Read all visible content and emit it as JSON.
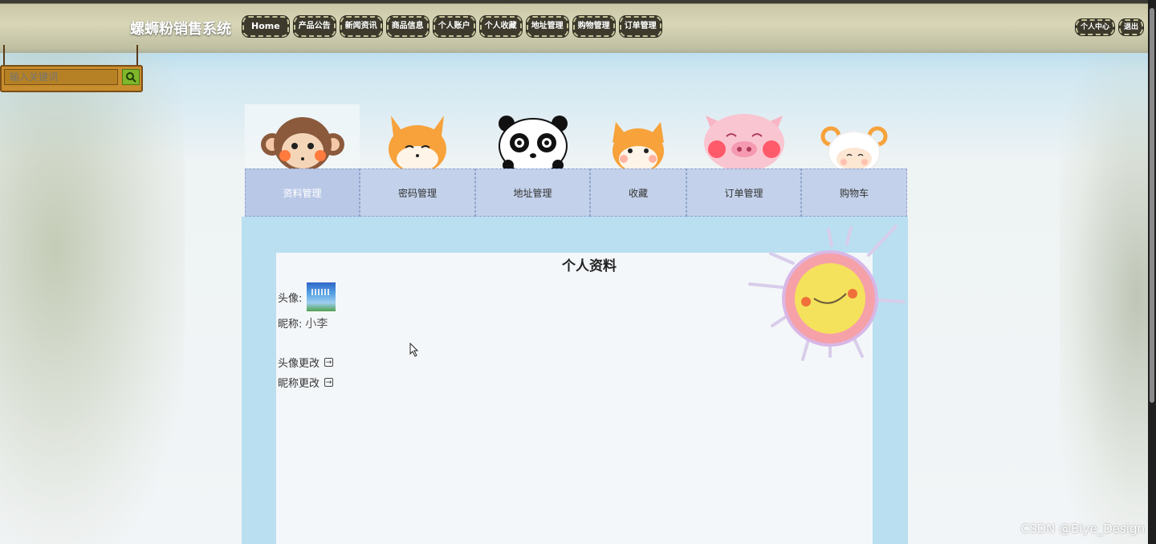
{
  "header": {
    "site_title": "螺蛳粉销售系统",
    "nav": [
      "Home",
      "产品公告",
      "新闻资讯",
      "商品信息",
      "个人账户",
      "个人收藏",
      "地址管理",
      "购物管理",
      "订单管理"
    ],
    "user_center": "个人中心",
    "logout": "退出"
  },
  "search": {
    "placeholder": "输入关键词",
    "button_icon": "search-icon"
  },
  "tabs": [
    {
      "label": "资料管理",
      "icon": "monkey-icon",
      "active": true
    },
    {
      "label": "密码管理",
      "icon": "fox-icon"
    },
    {
      "label": "地址管理",
      "icon": "panda-icon"
    },
    {
      "label": "收藏",
      "icon": "cat-icon"
    },
    {
      "label": "订单管理",
      "icon": "pig-icon"
    },
    {
      "label": "购物车",
      "icon": "sheep-icon"
    }
  ],
  "profile": {
    "title": "个人资料",
    "avatar_label": "头像:",
    "nickname_label": "昵称:",
    "nickname_value": "小李",
    "change_avatar": "头像更改",
    "change_nickname": "昵称更改"
  },
  "watermark": "CSDN @Biye_Design",
  "colors": {
    "content_frame": "#b9dff1",
    "tab_pocket": "#c3d1ea",
    "search_board": "#c88d2c"
  }
}
